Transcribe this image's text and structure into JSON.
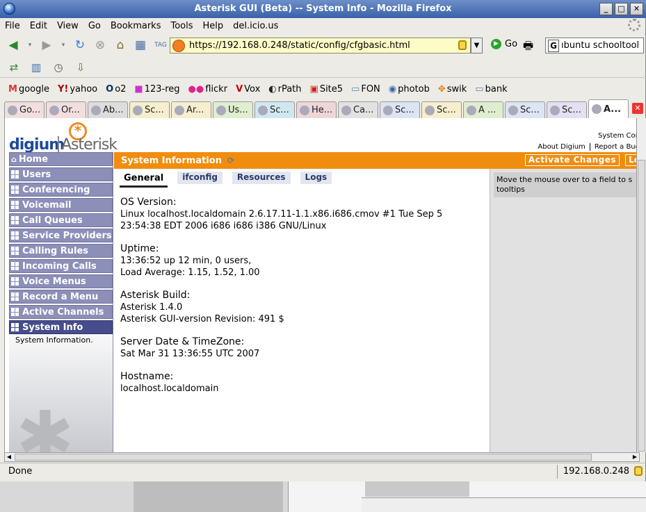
{
  "window": {
    "title": "Asterisk GUI (Beta) -- System Info - Mozilla Firefox",
    "buttons": [
      "_",
      "□",
      "✕"
    ]
  },
  "menu": [
    "File",
    "Edit",
    "View",
    "Go",
    "Bookmarks",
    "Tools",
    "Help",
    "del.icio.us"
  ],
  "nav": {
    "url": "https://192.168.0.248/static/config/cfgbasic.html",
    "go_label": "Go",
    "search_text": "ıbuntu schooltool"
  },
  "bookmarks": [
    {
      "icon": "M",
      "label": "google",
      "color": "#d33"
    },
    {
      "icon": "Y!",
      "label": "yahoo",
      "color": "#a00"
    },
    {
      "icon": "O",
      "label": "o2",
      "color": "#036"
    },
    {
      "icon": "■",
      "label": "123-reg",
      "color": "#c3c"
    },
    {
      "icon": "●●",
      "label": "flickr",
      "color": "#e0228c"
    },
    {
      "icon": "V",
      "label": "Vox",
      "color": "#c00"
    },
    {
      "icon": "◐",
      "label": "rPath",
      "color": "#222"
    },
    {
      "icon": "▣",
      "label": "Site5",
      "color": "#c22"
    },
    {
      "icon": "▭",
      "label": "FON",
      "color": "#58a"
    },
    {
      "icon": "◉",
      "label": "photob",
      "color": "#36a"
    },
    {
      "icon": "✥",
      "label": "swik",
      "color": "#d80"
    },
    {
      "icon": "▭",
      "label": "bank",
      "color": "#58a"
    }
  ],
  "tabs": [
    {
      "label": "Go...",
      "color": "#f2dede"
    },
    {
      "label": "Or...",
      "color": "#f2dede"
    },
    {
      "label": "Ab...",
      "color": "#ddd"
    },
    {
      "label": "Sc...",
      "color": "#f7eecd"
    },
    {
      "label": "Ar...",
      "color": "#f7eecd"
    },
    {
      "label": "Us...",
      "color": "#dfeecf"
    },
    {
      "label": "Sc...",
      "color": "#cfe8ef"
    },
    {
      "label": "He...",
      "color": "#efd6d6"
    },
    {
      "label": "Ca...",
      "color": "#e2e2e2"
    },
    {
      "label": "Sc...",
      "color": "#dde4f2"
    },
    {
      "label": "Sc...",
      "color": "#f7eecd"
    },
    {
      "label": "A ...",
      "color": "#dfeecf"
    },
    {
      "label": "Sc...",
      "color": "#dde4f2"
    },
    {
      "label": "Sc...",
      "color": "#e4dff2"
    },
    {
      "label": "A...",
      "color": "#ffffff"
    }
  ],
  "page": {
    "logo_digium": "digium",
    "logo_asterisk": "Asterisk",
    "top_links": {
      "system_con": "System Con",
      "about": "About Digium",
      "report": "Report a Bug"
    },
    "header_title": "System Information",
    "activate_label": "Activate Changes",
    "logout_label": "Lo",
    "sidebar": {
      "home": "Home",
      "items": [
        "Users",
        "Conferencing",
        "Voicemail",
        "Call Queues",
        "Service Providers",
        "Calling Rules",
        "Incoming Calls",
        "Voice Menus",
        "Record a Menu",
        "Active Channels"
      ],
      "active": "System Info",
      "sub": "System Information."
    },
    "subtabs": [
      "General",
      "ifconfig",
      "Resources",
      "Logs"
    ],
    "info": {
      "os_label": "OS Version:",
      "os_value1": "Linux localhost.localdomain 2.6.17.11-1.1.x86.i686.cmov #1 Tue Sep 5",
      "os_value2": "23:54:38 EDT 2006 i686 i686 i386 GNU/Linux",
      "uptime_label": "Uptime:",
      "uptime_value1": "13:36:52 up 12 min, 0 users,",
      "uptime_value2": "Load Average: 1.15, 1.52, 1.00",
      "build_label": "Asterisk Build:",
      "build_value1": "Asterisk 1.4.0",
      "build_value2": "Asterisk GUI-version Revision: 491 $",
      "date_label": "Server Date & TimeZone:",
      "date_value": "Sat Mar 31 13:36:55 UTC 2007",
      "host_label": "Hostname:",
      "host_value": "localhost.localdomain"
    },
    "tooltip": "Move the mouse over to a field to s tooltips"
  },
  "status": {
    "text": "Done",
    "ip": "192.168.0.248"
  },
  "colors": {
    "accent": "#f08d0e",
    "sidebar": "#8c8fb8",
    "sidebar_active": "#474d8a"
  }
}
